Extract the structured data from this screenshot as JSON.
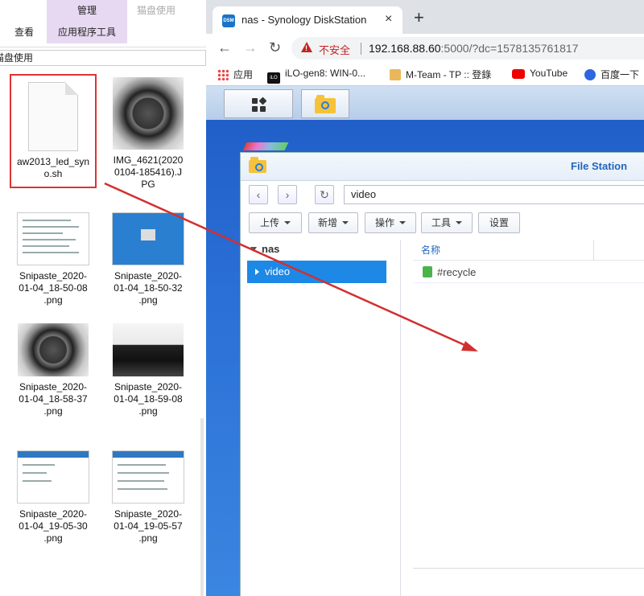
{
  "explorer": {
    "ribbon": {
      "manage": "管理",
      "disk_usage": "猫盘使用",
      "view": "查看",
      "app_tools": "应用程序工具"
    },
    "address": "猫盘使用",
    "files": [
      {
        "name": "aw2013_led_syno.sh",
        "name_lines": [
          "aw2013_led_syn",
          "o.sh"
        ],
        "selected": true
      },
      {
        "name": "IMG_4621(20200104-185416).JPG",
        "name_lines": [
          "IMG_4621(2020",
          "0104-185416).J",
          "PG"
        ]
      },
      {
        "name": "Snipaste_2020-01-04_18-50-08.png",
        "name_lines": [
          "Snipaste_2020-",
          "01-04_18-50-08",
          ".png"
        ]
      },
      {
        "name": "Snipaste_2020-01-04_18-50-32.png",
        "name_lines": [
          "Snipaste_2020-",
          "01-04_18-50-32",
          ".png"
        ]
      },
      {
        "name": "Snipaste_2020-01-04_18-58-37.png",
        "name_lines": [
          "Snipaste_2020-",
          "01-04_18-58-37",
          ".png"
        ]
      },
      {
        "name": "Snipaste_2020-01-04_18-59-08.png",
        "name_lines": [
          "Snipaste_2020-",
          "01-04_18-59-08",
          ".png"
        ]
      },
      {
        "name": "Snipaste_2020-01-04_19-05-30.png",
        "name_lines": [
          "Snipaste_2020-",
          "01-04_19-05-30",
          ".png"
        ]
      },
      {
        "name": "Snipaste_2020-01-04_19-05-57.png",
        "name_lines": [
          "Snipaste_2020-",
          "01-04_19-05-57",
          ".png"
        ]
      }
    ]
  },
  "browser": {
    "tab": {
      "favicon": "DSM",
      "title": "nas - Synology DiskStation",
      "close": "×"
    },
    "new_tab": "+",
    "insecure_label": "不安全",
    "url_host": "192.168.88.60",
    "url_rest": ":5000/?dc=1578135761817",
    "bookmarks": [
      {
        "label": "应用",
        "icon": "apps-grid-icon"
      },
      {
        "label": "iLO-gen8: WIN-0...",
        "icon": "ilo-icon",
        "badge": "iLO"
      },
      {
        "label": "M-Team - TP :: 登錄",
        "icon": "mteam-icon"
      },
      {
        "label": "YouTube",
        "icon": "youtube-icon"
      },
      {
        "label": "百度一下",
        "icon": "baidu-icon"
      }
    ]
  },
  "file_station": {
    "title": "File Station",
    "path": "video",
    "actions": [
      {
        "label": "上传",
        "dropdown": true
      },
      {
        "label": "新增",
        "dropdown": true
      },
      {
        "label": "操作",
        "dropdown": true
      },
      {
        "label": "工具",
        "dropdown": true
      },
      {
        "label": "设置",
        "dropdown": false
      }
    ],
    "tree_root": "nas",
    "tree_selected": "video",
    "column_name": "名称",
    "rows": [
      {
        "name": "#recycle",
        "icon": "recycle-bin-icon"
      }
    ]
  },
  "colors": {
    "selection_border": "#dd3333",
    "arrow": "#d32f2f",
    "dsm_blue": "#1d88e6",
    "insecure_red": "#c5221f"
  }
}
